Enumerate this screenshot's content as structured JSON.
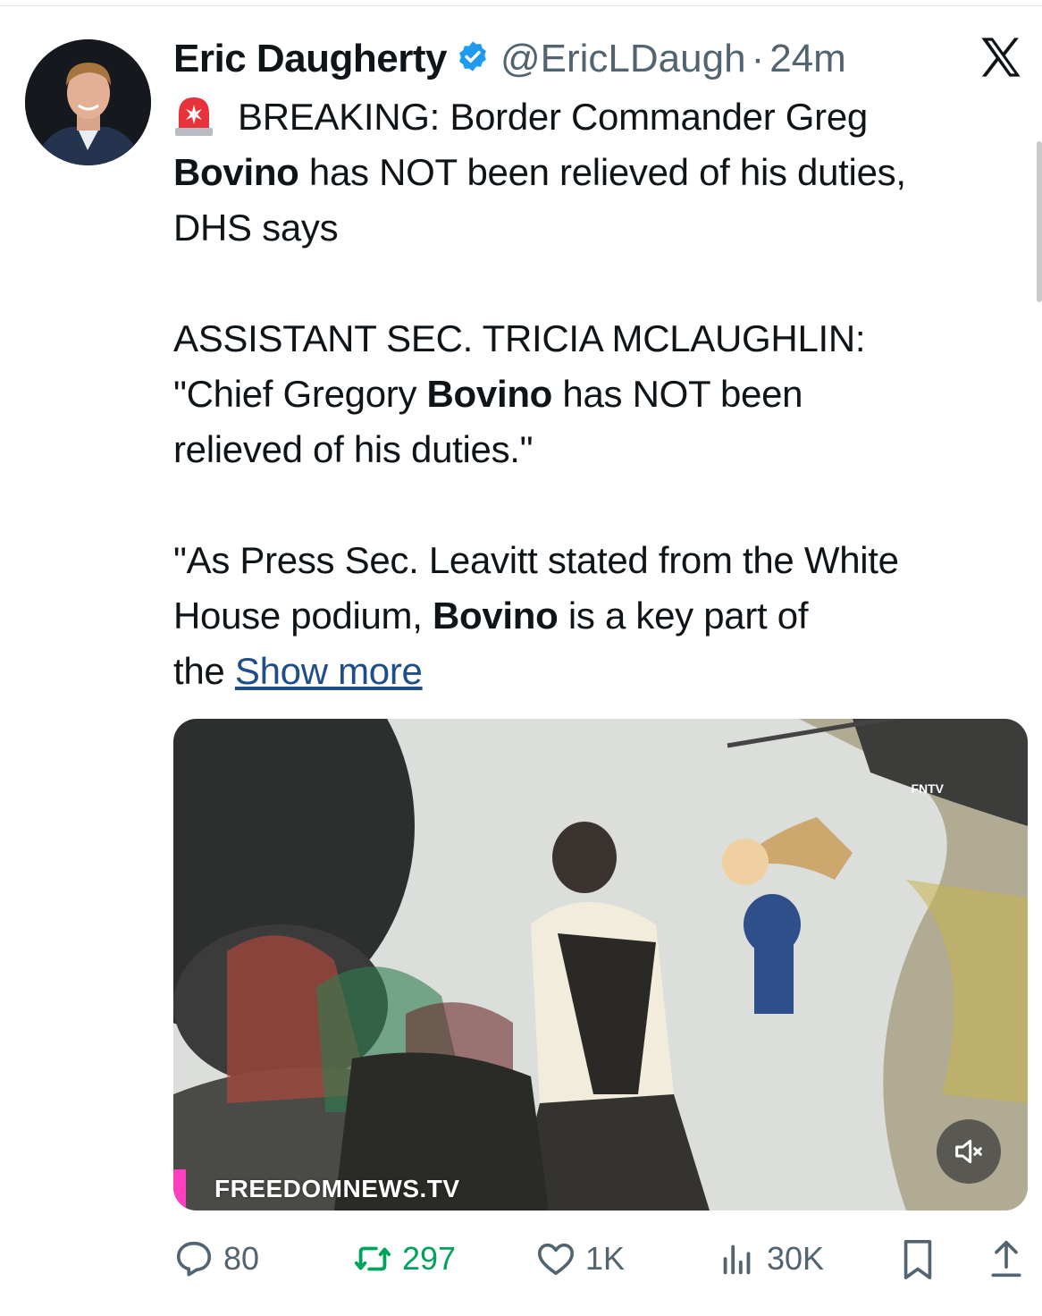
{
  "author": {
    "name": "Eric Daugherty",
    "handle": "@EricLDaugh",
    "separator": "·",
    "time": "24m",
    "verified": true
  },
  "tweet": {
    "line1_prefix": "BREAKING: Border Commander Greg",
    "line2_bold": "Bovino",
    "line2_rest": " has NOT been relieved of his duties,",
    "line3": "DHS says",
    "para2_line1": "ASSISTANT SEC. TRICIA MCLAUGHLIN:",
    "para2_line2_a": "\"Chief Gregory ",
    "para2_line2_bold": "Bovino",
    "para2_line2_b": " has NOT been",
    "para2_line3": "relieved of his duties.\"",
    "para3_line1": "\"As Press Sec. Leavitt stated from the White",
    "para3_line2_a": "House podium, ",
    "para3_line2_bold": "Bovino",
    "para3_line2_b": " is a key part of",
    "para3_line3_a": "the ",
    "show_more": "Show more"
  },
  "media": {
    "watermark": "FREEDOMNEWS.TV",
    "corner_logo": "FNTV",
    "mute_icon": "speaker-muted-icon"
  },
  "actions": {
    "replies": "80",
    "retweets": "297",
    "likes": "1K",
    "views": "30K"
  },
  "colors": {
    "text": "#0f1419",
    "secondary": "#536471",
    "link": "#1d4e89",
    "verified": "#1d9bf0",
    "retweet": "#00a35a"
  }
}
